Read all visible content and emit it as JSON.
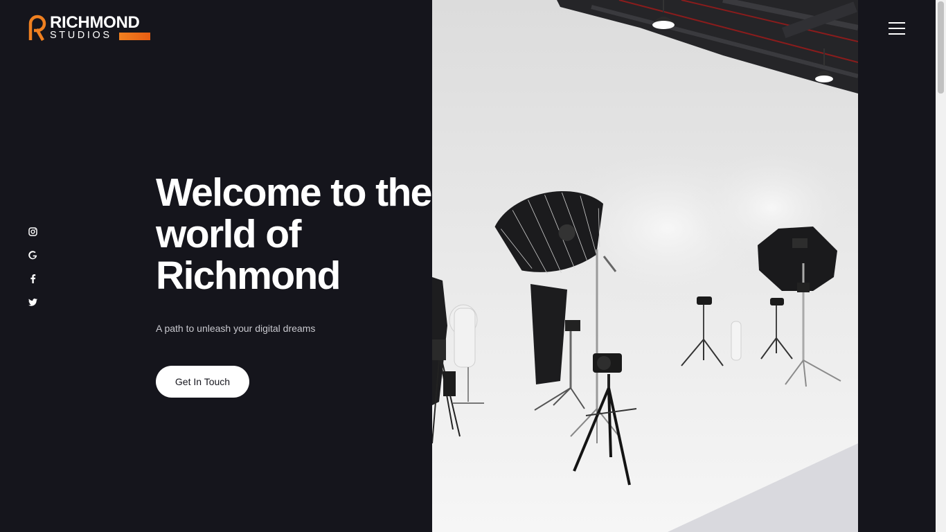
{
  "brand": {
    "name_top": "RICHMOND",
    "name_bottom": "STUDIOS",
    "accent_color": "#f08020"
  },
  "social": [
    {
      "icon": "instagram-icon"
    },
    {
      "icon": "google-icon"
    },
    {
      "icon": "facebook-icon"
    },
    {
      "icon": "twitter-icon"
    }
  ],
  "hero": {
    "title_line1": "Welcome to the",
    "title_line2": "world of",
    "title_line3": "Richmond",
    "subtitle": "A path to unleash your digital dreams",
    "cta_label": "Get In Touch"
  },
  "header": {
    "menu_icon": "hamburger-menu-icon"
  },
  "colors": {
    "background": "#15151c",
    "text": "#ffffff",
    "button_bg": "#ffffff"
  }
}
